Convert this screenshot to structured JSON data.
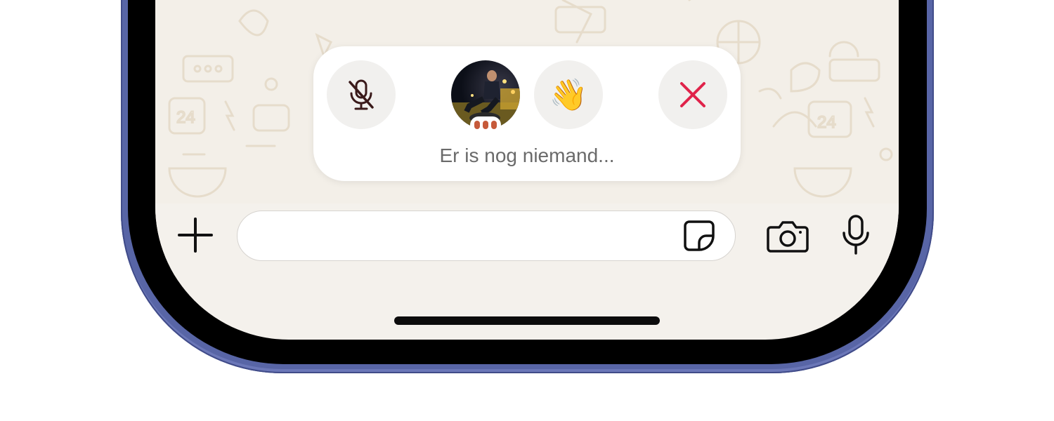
{
  "voice_chat": {
    "status_text": "Er is nog niemand...",
    "wave_emoji": "👋",
    "mute_icon": "mic-off-icon",
    "close_icon": "close-icon",
    "avatar_label": "participant-avatar"
  },
  "input_bar": {
    "placeholder": "",
    "plus_icon": "plus-icon",
    "sticker_icon": "sticker-icon",
    "camera_icon": "camera-icon",
    "mic_icon": "microphone-icon"
  },
  "colors": {
    "close_red": "#e0234a",
    "wallpaper": "#f3efe8",
    "status_text": "#6a6a6a",
    "phone_frame": "#5865a6",
    "typing_dots": "#c65a3a"
  }
}
